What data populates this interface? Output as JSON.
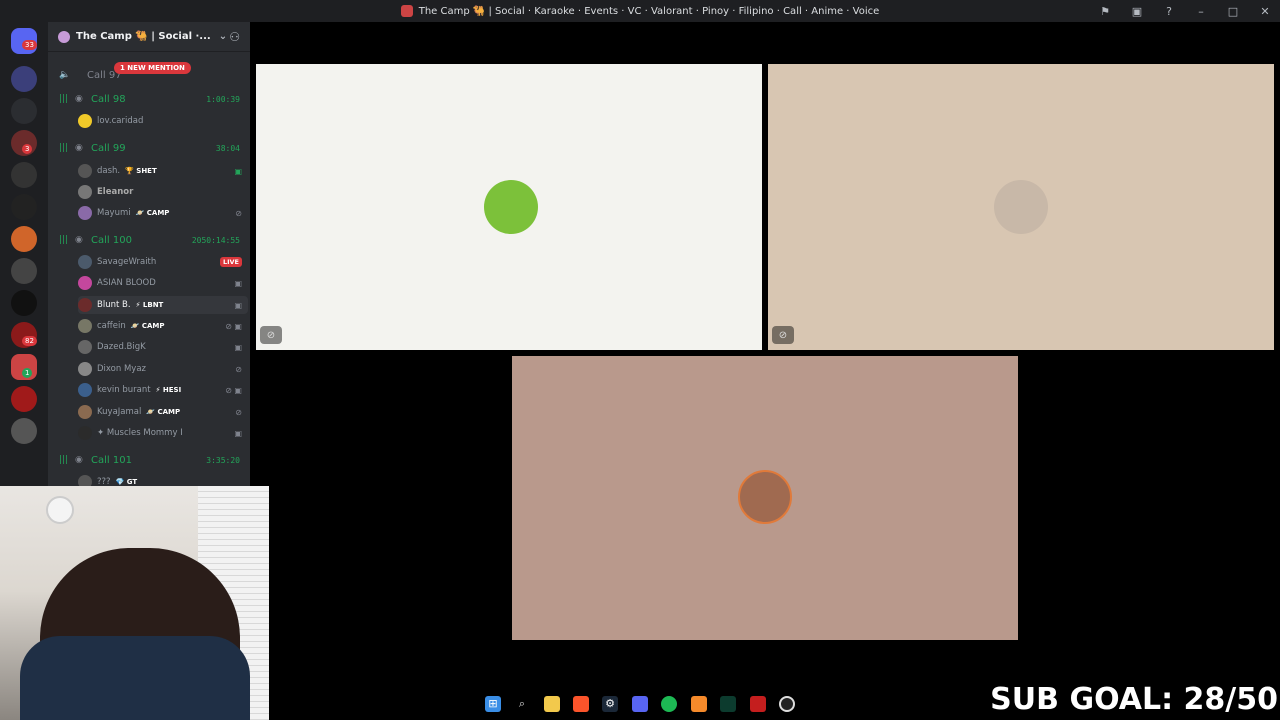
{
  "window": {
    "title": "The Camp 🐫 | Social · Karaoke · Events · VC · Valorant · Pinoy · Filipino · Call · Anime · Voice",
    "controls": [
      "⚑",
      "▣",
      "?",
      "–",
      "□",
      "✕"
    ]
  },
  "guilds": {
    "home_badge": "33",
    "badges": [
      "3",
      "82",
      "1"
    ]
  },
  "server": {
    "name": "The Camp 🐫 | Social ·...",
    "new_mention": "1 NEW MENTION",
    "partial_channel": "Call 97"
  },
  "channels": [
    {
      "name": "Call 98",
      "timer": "1:00:39",
      "users": [
        {
          "name": "lov.caridad",
          "color": "#f0c929"
        }
      ]
    },
    {
      "name": "Call 99",
      "timer": "38:04",
      "users": [
        {
          "name": "dash.",
          "tag": "🏆 SHET",
          "color": "#555"
        },
        {
          "name": "Eleanor",
          "color": "#777"
        },
        {
          "name": "Mayumi",
          "tag": "🪐 CAMP",
          "color": "#8a6aa8",
          "right": "mute"
        }
      ]
    },
    {
      "name": "Call 100",
      "timer": "2050:14:55",
      "users": [
        {
          "name": "SavageWraith",
          "color": "#4b5a6b",
          "right": "live"
        },
        {
          "name": "ASIAN BLOOD",
          "color": "#c4479d"
        },
        {
          "name": "Blunt B.",
          "tag": "⚡ LBNT",
          "color": "#6b2b2b"
        },
        {
          "name": "caffein",
          "tag": "🪐 CAMP",
          "color": "#776"
        },
        {
          "name": "Dazed.BigK",
          "color": "#666"
        },
        {
          "name": "Dixon Myaz",
          "color": "#888"
        },
        {
          "name": "kevin burant",
          "tag": "⚡ HESI",
          "color": "#3b5f8c"
        },
        {
          "name": "KuyaJamal",
          "tag": "🪐 CAMP",
          "color": "#8a6a50"
        },
        {
          "name": "✦ Muscles Mommy I",
          "color": "#2b2b2b"
        }
      ]
    },
    {
      "name": "Call 101",
      "timer": "3:35:20",
      "users": [
        {
          "name": "???",
          "tag": "💎 GT",
          "color": "#555"
        }
      ]
    }
  ],
  "stage": {
    "tiles": [
      {
        "bg": "#f3f3ef",
        "avatar_color": "#7cc13a",
        "muted": true
      },
      {
        "bg": "#d8c6b2",
        "avatar_color": "#c8b8a8",
        "muted": true
      },
      {
        "bg": "#b9998c",
        "avatar_color": "#a06a50",
        "muted": false
      }
    ]
  },
  "overlay": {
    "sub_goal": "SUB GOAL: 28/50"
  },
  "taskbar": {
    "icons": [
      "windows-start",
      "search",
      "file-explorer",
      "brave",
      "steam",
      "discord",
      "spotify",
      "app-orange",
      "terminal",
      "app-x",
      "obs"
    ]
  }
}
